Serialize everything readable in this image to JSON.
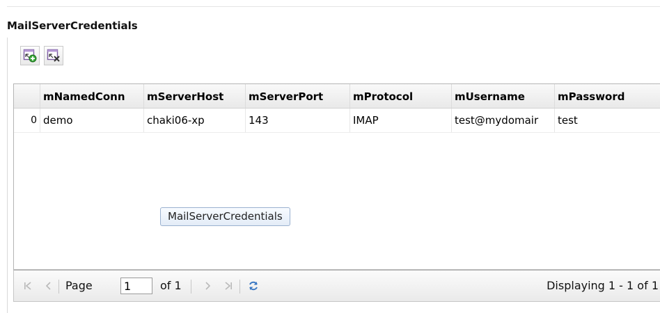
{
  "panel": {
    "title": "MailServerCredentials"
  },
  "toolbar": {
    "add_icon": "add-record-icon",
    "delete_icon": "delete-record-icon"
  },
  "grid": {
    "columns": [
      "",
      "mNamedConn",
      "mServerHost",
      "mServerPort",
      "mProtocol",
      "mUsername",
      "mPassword"
    ],
    "rows": [
      [
        "0",
        "demo",
        "chaki06-xp",
        "143",
        "IMAP",
        "test@mydomair",
        "test"
      ]
    ],
    "tooltip": "MailServerCredentials"
  },
  "pager": {
    "page_label": "Page",
    "page_value": "1",
    "of_label": "of 1",
    "display_text": "Displaying 1 - 1 of 1",
    "icons": [
      "first-page-icon",
      "prev-page-icon",
      "next-page-icon",
      "last-page-icon",
      "refresh-icon"
    ]
  },
  "colors": {
    "refresh": "#3a78c3",
    "border": "#b5b5b5"
  }
}
